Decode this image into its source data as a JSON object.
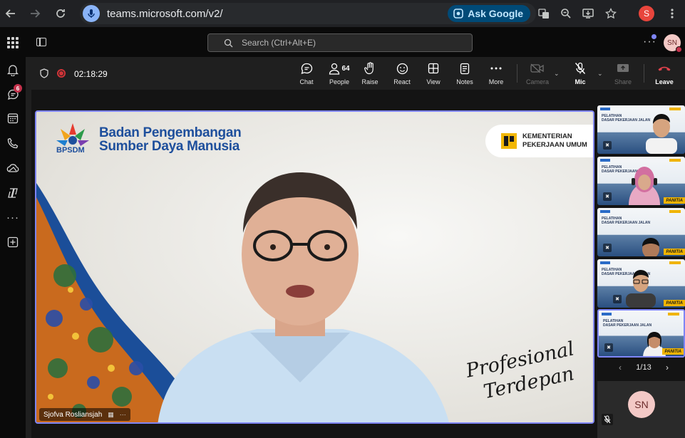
{
  "browser": {
    "url": "teams.microsoft.com/v2/",
    "ask_google_label": "Ask Google",
    "profile_initial": "S"
  },
  "teams_header": {
    "search_placeholder": "Search (Ctrl+Alt+E)",
    "user_initials": "SN",
    "more_label": "···"
  },
  "left_rail": {
    "chat_badge": "6",
    "more_label": "···"
  },
  "meeting": {
    "timer": "02:18:29",
    "toolbar": {
      "chat": "Chat",
      "people": "People",
      "people_count": "64",
      "raise": "Raise",
      "react": "React",
      "view": "View",
      "notes": "Notes",
      "more": "More",
      "camera": "Camera",
      "mic": "Mic",
      "share": "Share",
      "leave": "Leave"
    },
    "main_video": {
      "org_line1": "Badan Pengembangan",
      "org_line2": "Sumber Daya Manusia",
      "org_abbrev": "BPSDM",
      "ministry_line1": "KEMENTERIAN",
      "ministry_line2": "PEKERJAAN UMUM",
      "tagline_line1": "Profesional",
      "tagline_line2": "Terdepan",
      "speaker_name": "Sjofva Rosliansjah"
    },
    "thumbnails": {
      "slide_title_line1": "PELATIHAN",
      "slide_title_line2": "DASAR PEKERJAAN JALAN",
      "panitia_label": "PANITIA"
    },
    "pager": {
      "label": "1/13",
      "prev": "‹",
      "next": "›"
    },
    "self_view": {
      "initials": "SN"
    }
  },
  "colors": {
    "accent": "#7f85f5",
    "record": "#d13438",
    "leave": "#e0424c",
    "brand_blue": "#1e4f9c"
  }
}
